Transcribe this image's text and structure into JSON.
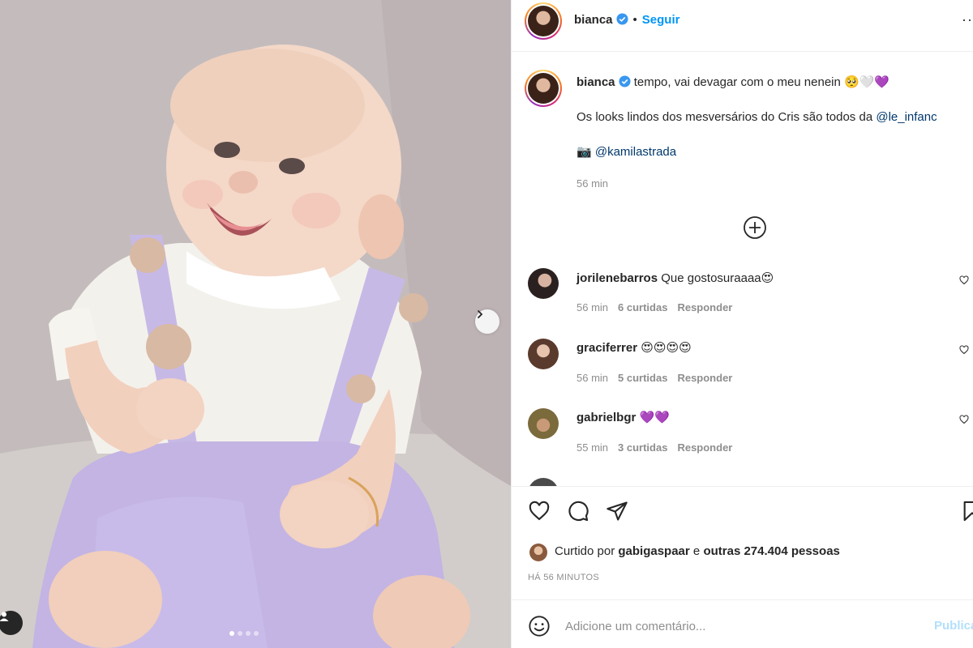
{
  "post": {
    "username": "bianca",
    "follow_label": "Seguir",
    "separator": "•",
    "more_label": "···",
    "caption": {
      "text": "tempo, vai devagar com o meu nenein",
      "emojis": "🥺🤍💜",
      "line2_text": "Os looks lindos dos mesversários do Cris são todos da",
      "line2_mention": "@le_infanc",
      "line3_icon": "📷",
      "line3_mention": "@kamilastrada",
      "time": "56 min"
    },
    "image_dots": 4,
    "active_dot": 0
  },
  "comments": [
    {
      "user": "jorilenebarros",
      "text": "Que gostosuraaaa",
      "emoji": "😍",
      "time": "56 min",
      "likes": "6 curtidas",
      "reply": "Responder"
    },
    {
      "user": "graciferrer",
      "text": "",
      "emoji": "😍😍😍😍",
      "time": "56 min",
      "likes": "5 curtidas",
      "reply": "Responder"
    },
    {
      "user": "gabrielbgr",
      "text": "",
      "emoji": "💜💜",
      "time": "55 min",
      "likes": "3 curtidas",
      "reply": "Responder"
    }
  ],
  "likes": {
    "prefix": "Curtido por",
    "user": "gabigaspaar",
    "conj": "e",
    "others": "outras 274.404 pessoas",
    "posted": "HÁ 56 MINUTOS"
  },
  "add_comment": {
    "placeholder": "Adicione um comentário...",
    "publish_label": "Publicar"
  },
  "icons": [
    "verified-badge-icon",
    "add-circle-icon",
    "heart-icon",
    "comment-icon",
    "share-icon",
    "bookmark-icon",
    "emoji-icon",
    "chevron-right-icon",
    "user-tag-icon"
  ],
  "colors": {
    "accent": "#0095f6",
    "mention": "#00376b",
    "muted": "#8e8e8e",
    "verified": "#3897f0",
    "shorts": "#c7b9e6"
  }
}
